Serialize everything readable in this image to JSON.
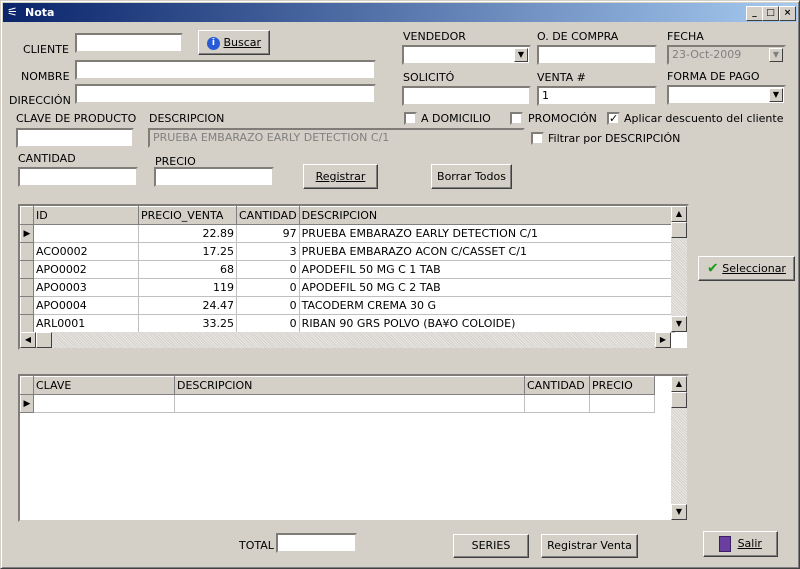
{
  "window": {
    "title": "Nota"
  },
  "labels": {
    "cliente": "CLIENTE",
    "nombre": "NOMBRE",
    "direccion": "DIRECCIÓN",
    "vendedor": "VENDEDOR",
    "o_compra": "O. DE COMPRA",
    "fecha": "FECHA",
    "solicito": "SOLICITÓ",
    "venta": "VENTA #",
    "forma_pago": "FORMA DE PAGO",
    "clave_producto": "CLAVE DE PRODUCTO",
    "descripcion": "DESCRIPCION",
    "cantidad": "CANTIDAD",
    "precio": "PRECIO",
    "total": "TOTAL"
  },
  "fields": {
    "cliente": "",
    "nombre": "",
    "direccion": "",
    "vendedor": "",
    "o_compra": "",
    "fecha": "23-Oct-2009",
    "solicito": "",
    "venta": "1",
    "forma_pago": "",
    "clave_producto": "",
    "descripcion": "PRUEBA EMBARAZO  EARLY DETECTION C/1",
    "cantidad": "",
    "precio": "",
    "total": ""
  },
  "checkboxes": {
    "a_domicilio": {
      "label": "A DOMICILIO",
      "checked": false
    },
    "promocion": {
      "label": "PROMOCIÓN",
      "checked": false
    },
    "descuento": {
      "label": "Aplicar descuento del cliente",
      "checked": true
    },
    "filtrar": {
      "label": "Filtrar por DESCRIPCIÓN",
      "checked": false
    }
  },
  "buttons": {
    "buscar": "Buscar",
    "registrar": "Registrar",
    "borrar_todos": "Borrar Todos",
    "seleccionar": "Seleccionar",
    "series": "SERIES",
    "registrar_venta": "Registrar Venta",
    "salir": "Salir"
  },
  "products_grid": {
    "columns": [
      "ID",
      "PRECIO_VENTA",
      "CANTIDAD",
      "DESCRIPCION"
    ],
    "rows": [
      [
        "",
        "22.89",
        "97",
        "PRUEBA EMBARAZO  EARLY DETECTION C/1"
      ],
      [
        "ACO0002",
        "17.25",
        "3",
        "PRUEBA EMBARAZO ACON C/CASSET C/1"
      ],
      [
        "APO0002",
        "68",
        "0",
        "APODEFIL 50 MG C 1 TAB"
      ],
      [
        "APO0003",
        "119",
        "0",
        "APODEFIL 50 MG C 2 TAB"
      ],
      [
        "APO0004",
        "24.47",
        "0",
        "TACODERM CREMA 30 G"
      ],
      [
        "ARL0001",
        "33.25",
        "0",
        "RIBAN 90 GRS POLVO (BA¥O COLOIDE)"
      ]
    ]
  },
  "items_grid": {
    "columns": [
      "CLAVE",
      "DESCRIPCION",
      "CANTIDAD",
      "PRECIO"
    ],
    "rows": [
      [
        "",
        "",
        "",
        ""
      ]
    ]
  }
}
